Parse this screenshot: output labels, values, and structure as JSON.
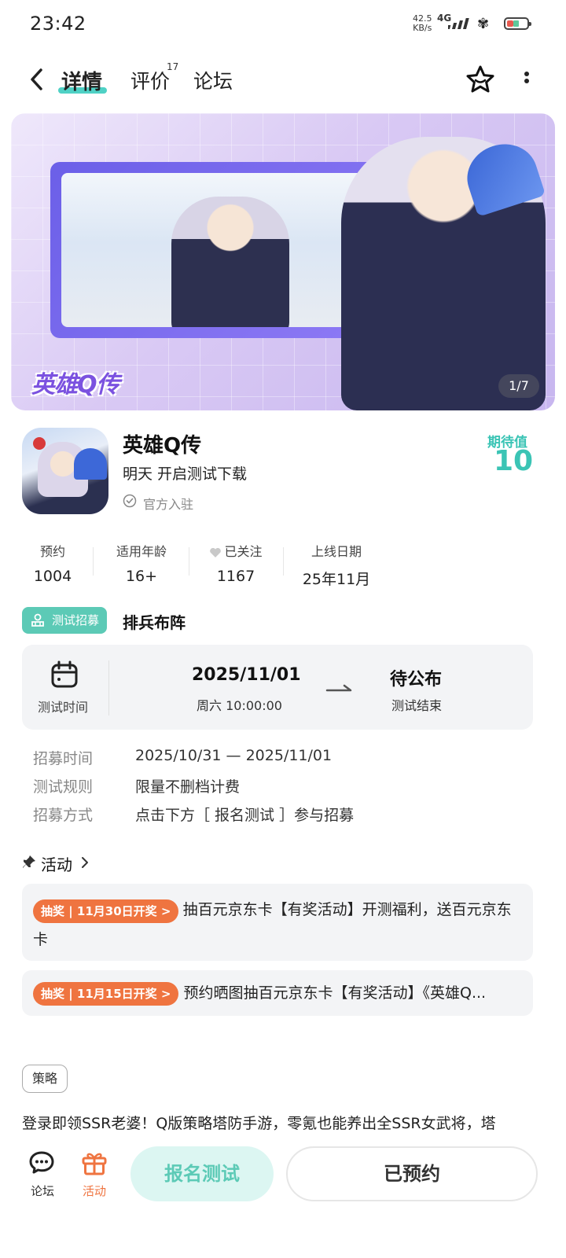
{
  "status_bar": {
    "time": "23:42",
    "net_speed_value": "42.5",
    "net_speed_unit": "KB/s",
    "network": "4G",
    "icons": [
      "signal-icon",
      "butterfly-icon",
      "battery-icon"
    ]
  },
  "nav": {
    "tabs": [
      {
        "label": "详情",
        "active": true
      },
      {
        "label": "评价",
        "count": "17"
      },
      {
        "label": "论坛"
      }
    ],
    "icons": [
      "back-icon",
      "star-icon",
      "more-icon"
    ]
  },
  "banner": {
    "logo_text": "英雄Q传",
    "page_indicator": "1/7"
  },
  "game": {
    "title": "英雄Q传",
    "subtitle": "明天 开启测试下载",
    "official": "官方入驻",
    "expect_label": "期待值",
    "expect_value": "10"
  },
  "stats": [
    {
      "label": "预约",
      "value": "1004"
    },
    {
      "label": "适用年龄",
      "value": "16+"
    },
    {
      "label": "已关注",
      "value": "1167"
    },
    {
      "label": "上线日期",
      "value": "25年11月"
    }
  ],
  "recruit": {
    "tag": "测试招募",
    "title": "排兵布阵"
  },
  "test_card": {
    "time_label": "测试时间",
    "start_date": "2025/11/01",
    "start_time": "周六  10:00:00",
    "end_title": "待公布",
    "end_label": "测试结束"
  },
  "rules": [
    {
      "label": "招募时间",
      "value": "2025/10/31 — 2025/11/01"
    },
    {
      "label": "测试规则",
      "value": "限量不删档计费"
    },
    {
      "label": "招募方式",
      "value": "点击下方［ 报名测试 ］参与招募"
    }
  ],
  "activity": {
    "title": "活动",
    "items": [
      {
        "badge": "抽奖 | 11月30日开奖 >",
        "text": "抽百元京东卡【有奖活动】开测福利，送百元京东卡"
      },
      {
        "badge": "抽奖 | 11月15日开奖 >",
        "text": "预约晒图抽百元京东卡【有奖活动】《英雄Q..."
      }
    ]
  },
  "strategy": {
    "tag": "策略",
    "description": "登录即领SSR老婆！Q版策略塔防手游，零氪也能养出全SSR女武将，塔"
  },
  "bottom_bar": {
    "forum_label": "论坛",
    "activity_label": "活动",
    "signup_label": "报名测试",
    "reserved_label": "已预约"
  },
  "colors": {
    "accent": "#4fd1c5",
    "accent_text": "#3bc4b5",
    "lottery": "#ef7440",
    "activity_tab": "#ef7440"
  }
}
